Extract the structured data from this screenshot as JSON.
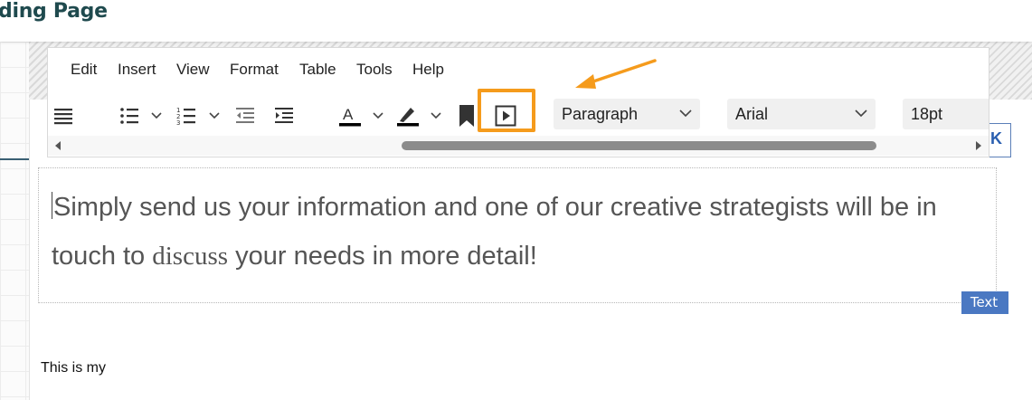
{
  "page": {
    "title": "ding Page"
  },
  "menu": [
    "Edit",
    "Insert",
    "View",
    "Format",
    "Table",
    "Tools",
    "Help"
  ],
  "toolbar": {
    "icons": [
      "align-justify-icon",
      "bullet-list-icon",
      "numbered-list-icon",
      "outdent-icon",
      "indent-icon",
      "text-color-icon",
      "highlight-icon",
      "bookmark-icon",
      "media-embed-icon"
    ],
    "block_format": "Paragraph",
    "font_family": "Arial",
    "font_size": "18pt",
    "highlight_color": "#f59b1c"
  },
  "editor": {
    "line1": "Simply send us your information and one of our creative strategists will be in",
    "line2_pre": "touch to ",
    "line2_word": "discuss",
    "line2_post": " your needs in more detail!"
  },
  "badge": {
    "label": "Text"
  },
  "right_peek": {
    "label": "K"
  },
  "below_text": "This is my"
}
